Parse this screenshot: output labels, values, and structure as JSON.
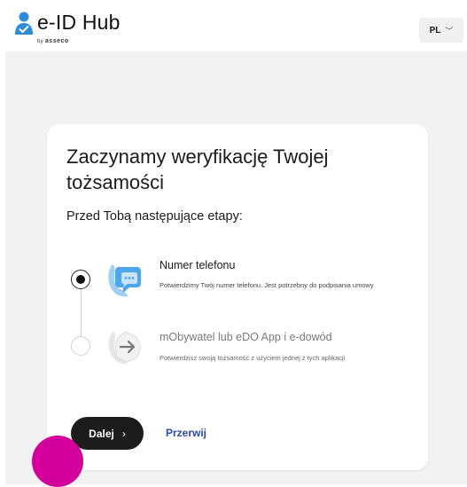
{
  "header": {
    "logo_text": "e-ID Hub",
    "logo_sub_by": "by",
    "logo_sub_brand": "asseco",
    "language": "PL",
    "brand_color": "#2e8bd8"
  },
  "card": {
    "title": "Zaczynamy weryfikację Twojej tożsamości",
    "subtitle": "Przed Tobą następujące etapy:",
    "steps": [
      {
        "title": "Numer telefonu",
        "description": "Potwierdzimy Twój numer telefonu. Jest potrzebny do podpisania umowy",
        "state": "checked",
        "icon": "phone-chat-icon"
      },
      {
        "title": "mObywatel lub eDO App i e-dowód",
        "description": "Potwierdzisz swoją tożsamość z użyciem jednej z tych aplikacji",
        "state": "unchecked",
        "icon": "arrow-right-icon"
      }
    ],
    "next_button": "Dalej",
    "cancel_link": "Przerwij"
  },
  "colors": {
    "primary_button": "#1c1c1c",
    "link": "#2b4aa8",
    "chat_bubble": "#d4009b",
    "page_background": "#f2f2f2"
  }
}
